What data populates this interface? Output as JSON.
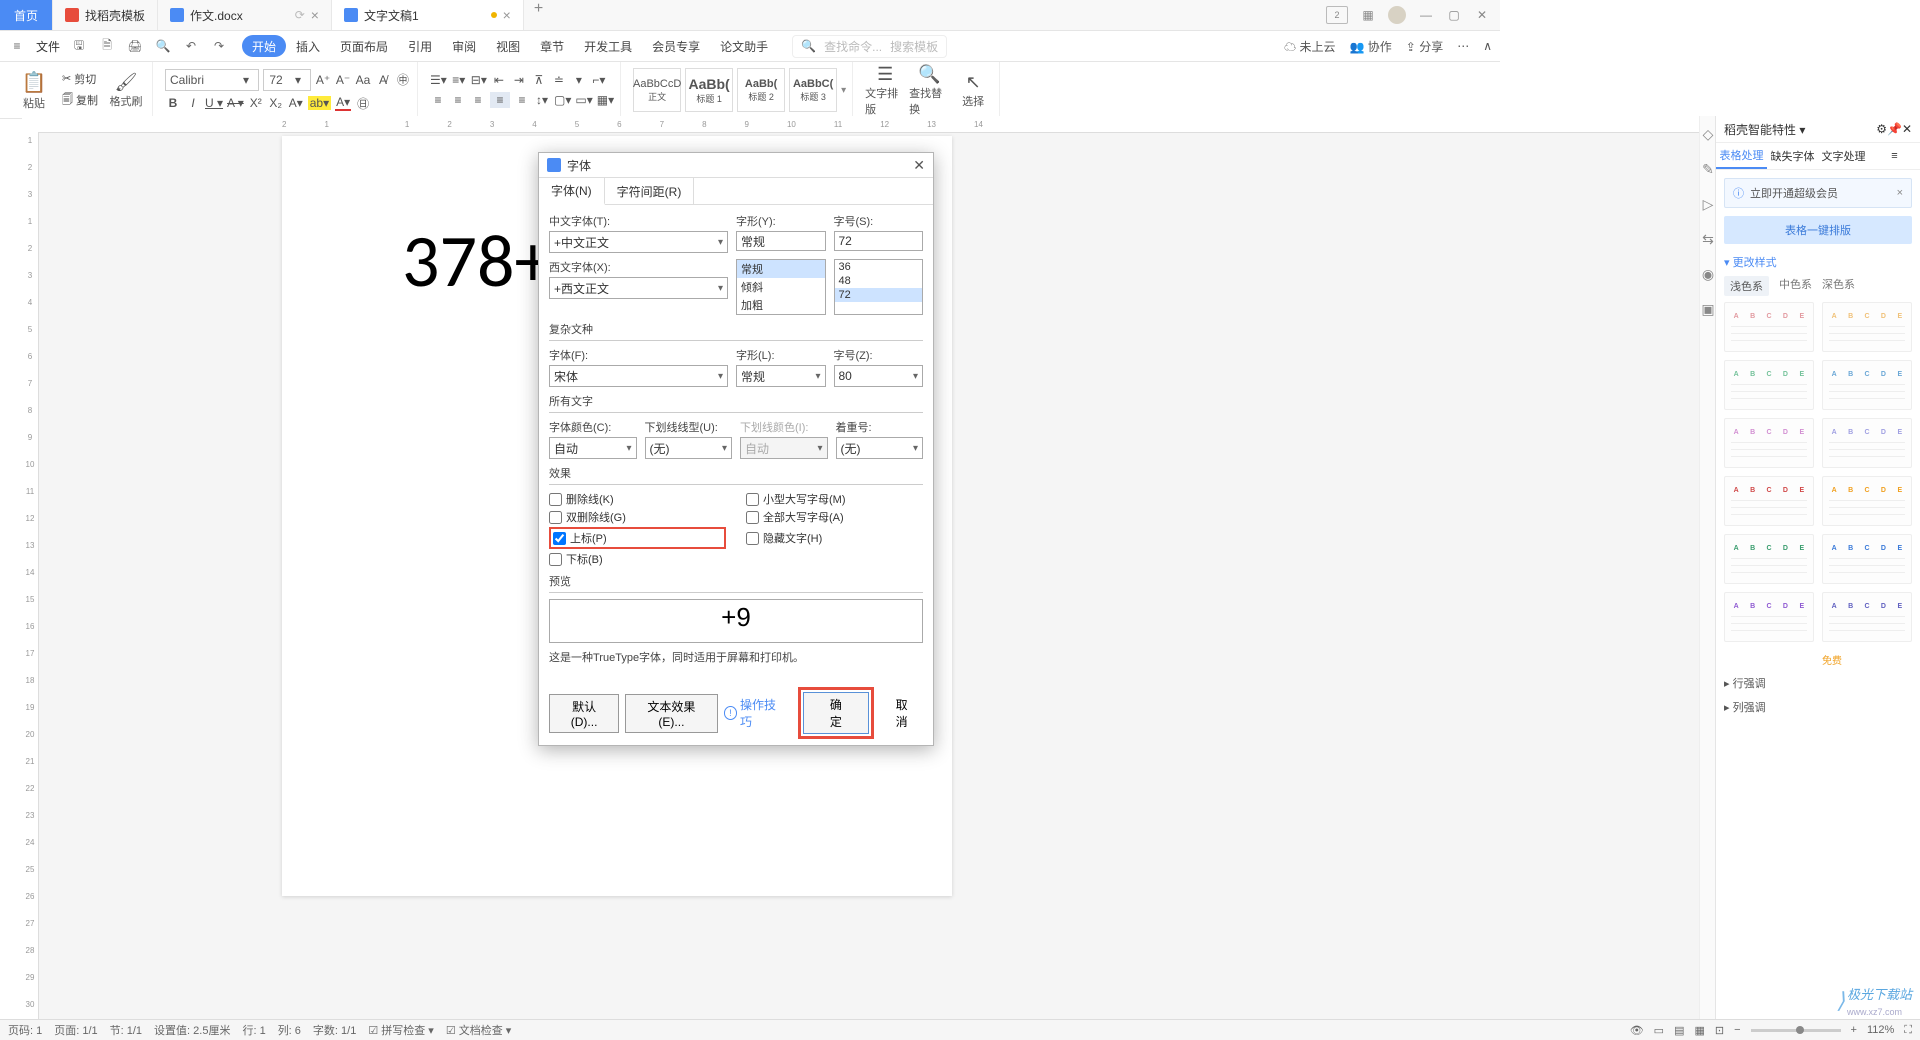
{
  "titlebar": {
    "home": "首页",
    "tabs": [
      {
        "label": "找稻壳模板"
      },
      {
        "label": "作文.docx"
      },
      {
        "label": "文字文稿1"
      }
    ],
    "right_label": "2"
  },
  "menubar": {
    "file": "文件",
    "tabs": [
      "开始",
      "插入",
      "页面布局",
      "引用",
      "审阅",
      "视图",
      "章节",
      "开发工具",
      "会员专享",
      "论文助手"
    ],
    "search_cmd": "查找命令...",
    "search_tpl": "搜索模板",
    "cloud": "未上云",
    "coop": "协作",
    "share": "分享"
  },
  "ribbon": {
    "paste": "粘贴",
    "cut": "剪切",
    "copy": "复制",
    "format_painter": "格式刷",
    "font_name": "Calibri",
    "font_size": "72",
    "styles": [
      {
        "prev": "AaBbCcD",
        "label": "正文"
      },
      {
        "prev": "AaBb(",
        "label": "标题 1"
      },
      {
        "prev": "AaBb(",
        "label": "标题 2"
      },
      {
        "prev": "AaBbC(",
        "label": "标题 3"
      }
    ],
    "text_layout": "文字排版",
    "find_replace": "查找替换",
    "select": "选择"
  },
  "document": {
    "text": "378+"
  },
  "dialog": {
    "title": "字体",
    "tab_font": "字体(N)",
    "tab_spacing": "字符间距(R)",
    "cn_font_lbl": "中文字体(T):",
    "cn_font_val": "+中文正文",
    "style_lbl": "字形(Y):",
    "style_val": "常规",
    "style_opts": [
      "常规",
      "倾斜",
      "加粗"
    ],
    "size_lbl": "字号(S):",
    "size_val": "72",
    "size_opts": [
      "36",
      "48",
      "72"
    ],
    "en_font_lbl": "西文字体(X):",
    "en_font_val": "+西文正文",
    "complex_lbl": "复杂文种",
    "complex_font_lbl": "字体(F):",
    "complex_font_val": "宋体",
    "complex_style_lbl": "字形(L):",
    "complex_style_val": "常规",
    "complex_size_lbl": "字号(Z):",
    "complex_size_val": "80",
    "all_text_lbl": "所有文字",
    "font_color_lbl": "字体颜色(C):",
    "font_color_val": "自动",
    "underline_lbl": "下划线线型(U):",
    "underline_val": "(无)",
    "underline_color_lbl": "下划线颜色(I):",
    "underline_color_val": "自动",
    "emphasis_lbl": "着重号:",
    "emphasis_val": "(无)",
    "effects_lbl": "效果",
    "eff_strike": "删除线(K)",
    "eff_dstrike": "双删除线(G)",
    "eff_super": "上标(P)",
    "eff_sub": "下标(B)",
    "eff_smallcaps": "小型大写字母(M)",
    "eff_allcaps": "全部大写字母(A)",
    "eff_hidden": "隐藏文字(H)",
    "preview_lbl": "预览",
    "preview_text": "+9",
    "note": "这是一种TrueType字体，同时适用于屏幕和打印机。",
    "btn_default": "默认(D)...",
    "btn_texteffect": "文本效果(E)...",
    "btn_tips": "操作技巧",
    "btn_ok": "确定",
    "btn_cancel": "取消"
  },
  "panel": {
    "title": "稻壳智能特性",
    "tab_table": "表格处理",
    "tab_missing": "缺失字体",
    "tab_text": "文字处理",
    "promo": "立即开通超级会员",
    "big_btn": "表格一键排版",
    "change_style": "更改样式",
    "color_light": "浅色系",
    "color_mid": "中色系",
    "color_dark": "深色系",
    "free": "免费",
    "row_emph": "行强调",
    "col_emph": "列强调"
  },
  "statusbar": {
    "page": "页码: 1",
    "pages": "页面: 1/1",
    "section": "节: 1/1",
    "pos": "设置值: 2.5厘米",
    "line": "行: 1",
    "col": "列: 6",
    "words": "字数: 1/1",
    "spell": "拼写检查",
    "doc_check": "文档检查",
    "zoom": "112%"
  },
  "watermark": {
    "main": "极光下载站",
    "sub": "www.xz7.com"
  },
  "thumb_heads": [
    [
      "A",
      "B",
      "C",
      "D",
      "E"
    ],
    [
      "A",
      "B",
      "C",
      "D",
      "E"
    ]
  ],
  "thumb_colors": [
    "#e29aa0",
    "#f0c178",
    "#74c29a",
    "#6aa7d6",
    "#d28fd2",
    "#a0a0e2",
    "#d04848",
    "#f0a020",
    "#3a9d6e",
    "#3a7ad9",
    "#8f5ad2",
    "#6060c0"
  ]
}
